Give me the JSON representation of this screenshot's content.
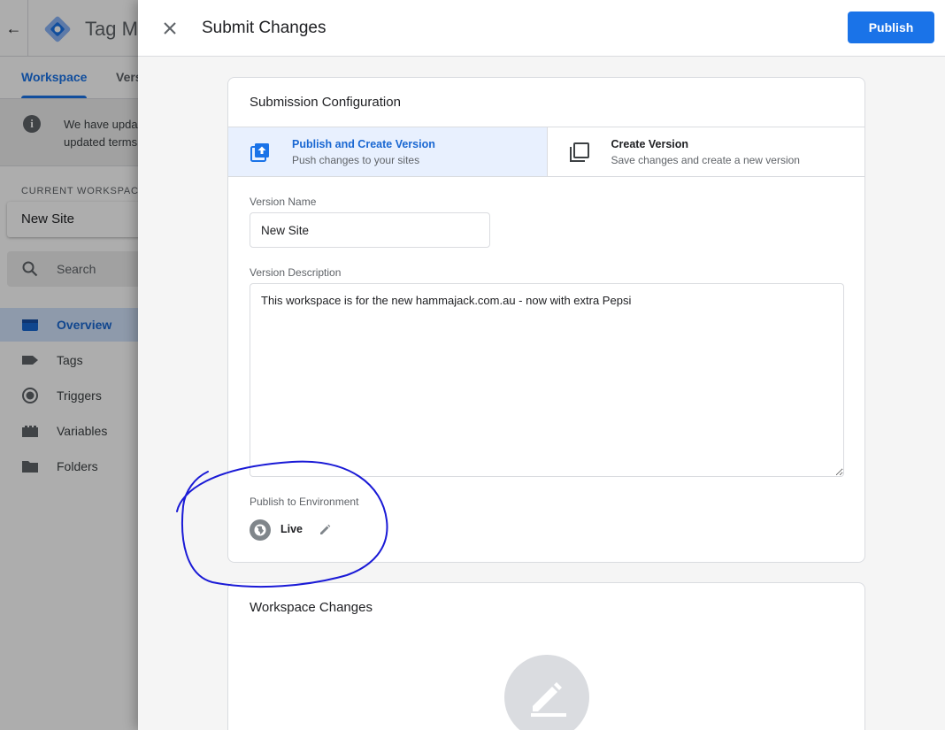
{
  "background_app": {
    "back_icon": "arrow-back-icon",
    "logo_icon": "tag-manager-logo-icon",
    "title": "Tag Ma",
    "tabs": [
      {
        "label": "Workspace",
        "active": true
      },
      {
        "label": "Vers",
        "active": false
      }
    ],
    "notice_icon": "info-icon",
    "notice_line1": "We have upda",
    "notice_line2": "updated terms",
    "current_workspace_label": "CURRENT WORKSPACE",
    "workspace_name": "New Site",
    "search_icon": "search-icon",
    "search_label": "Search",
    "nav": [
      {
        "label": "Overview",
        "icon": "overview-icon",
        "active": true
      },
      {
        "label": "Tags",
        "icon": "tag-icon",
        "active": false
      },
      {
        "label": "Triggers",
        "icon": "trigger-icon",
        "active": false
      },
      {
        "label": "Variables",
        "icon": "variables-icon",
        "active": false
      },
      {
        "label": "Folders",
        "icon": "folder-icon",
        "active": false
      }
    ]
  },
  "panel": {
    "close_icon": "close-icon",
    "title": "Submit Changes",
    "publish_label": "Publish",
    "accent_color": "#1a73e8"
  },
  "submission": {
    "title": "Submission Configuration",
    "options": [
      {
        "title": "Publish and Create Version",
        "subtitle": "Push changes to your sites",
        "icon": "publish-upload-icon",
        "selected": true
      },
      {
        "title": "Create Version",
        "subtitle": "Save changes and create a new version",
        "icon": "version-copy-icon",
        "selected": false
      }
    ],
    "version_name_label": "Version Name",
    "version_name_value": "New Site",
    "version_description_label": "Version Description",
    "version_description_value": "This workspace is for the new hammajack.com.au - now with extra Pepsi",
    "environment_label": "Publish to Environment",
    "environment_icon": "globe-icon",
    "environment_name": "Live",
    "environment_edit_icon": "pencil-edit-icon"
  },
  "workspace_changes": {
    "title": "Workspace Changes",
    "empty_icon": "pencil-edit-icon"
  },
  "annotation": {
    "color": "#1a1ad6",
    "shape": "hand-drawn-circle-around-environment"
  }
}
